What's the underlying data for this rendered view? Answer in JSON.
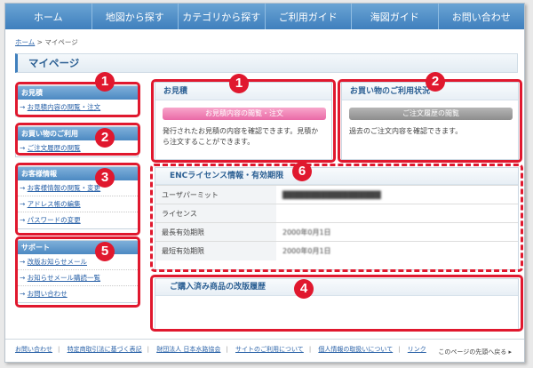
{
  "nav": [
    "ホーム",
    "地図から探す",
    "カテゴリから探す",
    "ご利用ガイド",
    "海図ガイド",
    "お問い合わせ"
  ],
  "breadcrumb": {
    "home": "ホーム",
    "sep": " > ",
    "current": "マイページ"
  },
  "page_title": "マイページ",
  "sidebar": [
    {
      "header": "お見積",
      "links": [
        "お見積内容の閲覧・注文"
      ]
    },
    {
      "header": "お買い物のご利用",
      "links": [
        "ご注文履歴の閲覧"
      ]
    },
    {
      "header": "お客様情報",
      "links": [
        "お客様情報の閲覧・変更",
        "アドレス帳の編集",
        "パスワードの変更"
      ]
    },
    {
      "header": "サポート",
      "links": [
        "改版お知らせメール",
        "お知らせメール購読一覧",
        "お問い合わせ"
      ]
    }
  ],
  "panels": {
    "quote": {
      "title": "お見積",
      "button": "お見積内容の閲覧・注文",
      "desc": "発行されたお見積の内容を確認できます。見積から注文することができます。"
    },
    "shopping": {
      "title": "お買い物のご利用状況",
      "button": "ご注文履歴の閲覧",
      "desc": "過去のご注文内容を確認できます。"
    }
  },
  "enc": {
    "title": "ENCライセンス情報・有効期限",
    "rows": [
      {
        "label": "ユーザパーミット",
        "value": "██████████████████"
      },
      {
        "label": "ライセンス",
        "value": ""
      },
      {
        "label": "最長有効期限",
        "value": "2000年0月1日"
      },
      {
        "label": "最短有効期限",
        "value": "2000年0月1日"
      }
    ]
  },
  "history": {
    "title": "ご購入済み商品の改版履歴"
  },
  "footer": {
    "links": [
      "お問い合わせ",
      "特定商取引法に基づく表記",
      "財団法人 日本水路協会",
      "サイトのご利用について",
      "個人情報の取扱いについて",
      "リンク"
    ],
    "back_to_top": "このページの先頭へ戻る ▸"
  },
  "markers": [
    "1",
    "2",
    "3",
    "5",
    "1",
    "2",
    "6",
    "4"
  ],
  "colors": {
    "accent": "#3f7fbd",
    "pink_button": "#f07bb0",
    "gray_button": "#9a9a9a",
    "annotation": "#e0182e"
  }
}
